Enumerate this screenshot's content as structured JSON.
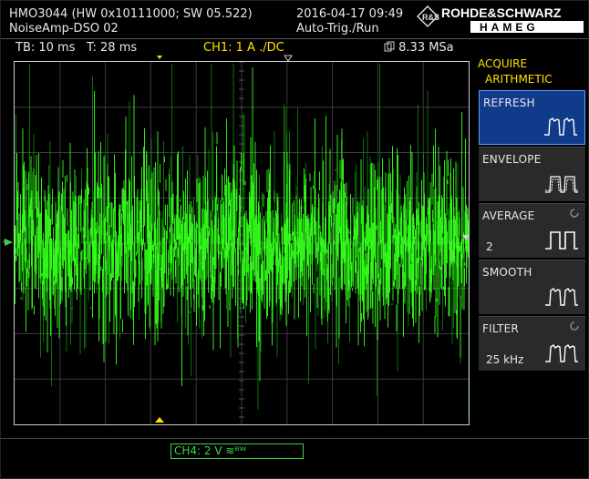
{
  "header": {
    "model_line": "HMO3044 (HW 0x10111000; SW 05.522)",
    "setup_name": "NoiseAmp-DSO 02",
    "datetime": "2016-04-17 09:49",
    "trigger_mode": "Auto-Trig./Run",
    "brand_top": "ROHDE&SCHWARZ",
    "brand_bottom": "HAMEG"
  },
  "status_bar": {
    "timebase": "TB: 10 ms",
    "trigger_time": "T: 28 ms",
    "channel1": "CH1: 1 A ./DC",
    "sample_rate": "8.33 MSa"
  },
  "side_menu": {
    "title1": "ACQUIRE",
    "title2": "ARITHMETIC",
    "items": [
      {
        "label": "REFRESH",
        "value": "",
        "active": true,
        "icon": "refresh-pulse-icon"
      },
      {
        "label": "ENVELOPE",
        "value": "",
        "active": false,
        "icon": "envelope-pulse-icon"
      },
      {
        "label": "AVERAGE",
        "value": "2",
        "active": false,
        "icon": "average-pulse-icon"
      },
      {
        "label": "SMOOTH",
        "value": "",
        "active": false,
        "icon": "smooth-pulse-icon"
      },
      {
        "label": "FILTER",
        "value": "25 kHz",
        "active": false,
        "icon": "filter-pulse-icon"
      }
    ]
  },
  "channel4_box": "CH4: 2 V ≋ᴮᵂ",
  "colors": {
    "trace": "#33ff1a",
    "trace_dark": "#0d8f0d",
    "channel1": "#ffe000",
    "channel4": "#3fd24a",
    "menu_active": "#103a8a"
  }
}
